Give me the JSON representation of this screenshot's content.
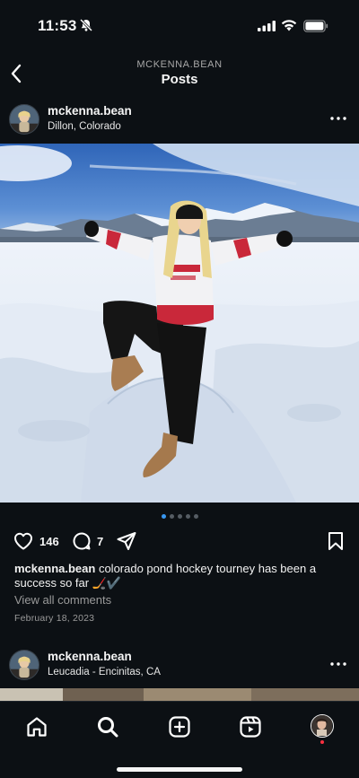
{
  "status_bar": {
    "time": "11:53"
  },
  "header": {
    "username": "MCKENNA.BEAN",
    "title": "Posts"
  },
  "post": {
    "username": "mckenna.bean",
    "location": "Dillon, Colorado",
    "likes": "146",
    "comments": "7",
    "caption_user": "mckenna.bean",
    "caption_text": "colorado pond hockey tourney has been a success so far 🏒✔️",
    "view_comments": "View all comments",
    "date": "February 18, 2023",
    "carousel": {
      "total": 5,
      "active": 1
    }
  },
  "next_post": {
    "username": "mckenna.bean",
    "location": "Leucadia - Encinitas, CA"
  },
  "tabbar": [
    "home",
    "search",
    "create",
    "reels",
    "profile"
  ],
  "colors": {
    "background": "#0c1014",
    "accent": "#3897f0",
    "notification": "#ff3040"
  }
}
